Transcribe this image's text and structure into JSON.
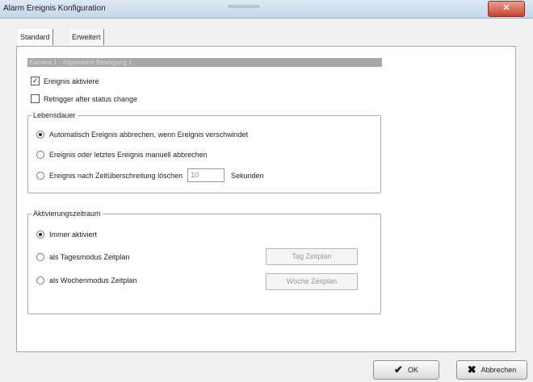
{
  "window": {
    "title": "Alarm Ereignis Konfiguration",
    "close_glyph": "✕"
  },
  "tabs": [
    {
      "label": "Standard",
      "active": true
    },
    {
      "label": "Erweitert",
      "active": false
    }
  ],
  "camera_bar": "Kamera 1 - Allgemeine Bewegung 1",
  "options": {
    "activate_event": {
      "label": "Ereignis aktiviere",
      "checked": true
    },
    "retrigger": {
      "label": "Retrigger after status change",
      "checked": false
    }
  },
  "lifetime_group": {
    "legend": "Lebensdauer",
    "radios": [
      {
        "label": "Automatisch Ereignis abbrechen, wenn Ereignis verschwindet",
        "checked": true
      },
      {
        "label": "Ereignis oder letztes Ereignis manuell abbrechen",
        "checked": false
      },
      {
        "label": "Ereignis nach Zeitüberschreitung löschen",
        "checked": false
      }
    ],
    "timeout_value": "10",
    "timeout_unit": "Sekunden"
  },
  "activation_group": {
    "legend": "Aktivierungszeitraum",
    "radios": [
      {
        "label": "Immer aktiviert",
        "checked": true
      },
      {
        "label": "als Tagesmodus Zeitplan",
        "checked": false
      },
      {
        "label": "als Wochenmodus Zeitplan",
        "checked": false
      }
    ],
    "day_schedule_button": "Tag Zeitplan",
    "week_schedule_button": "Woche Zeitplan"
  },
  "footer": {
    "ok_label": "OK",
    "ok_icon": "checkmark-icon",
    "cancel_label": "Abbrechen",
    "cancel_icon": "x-icon"
  }
}
